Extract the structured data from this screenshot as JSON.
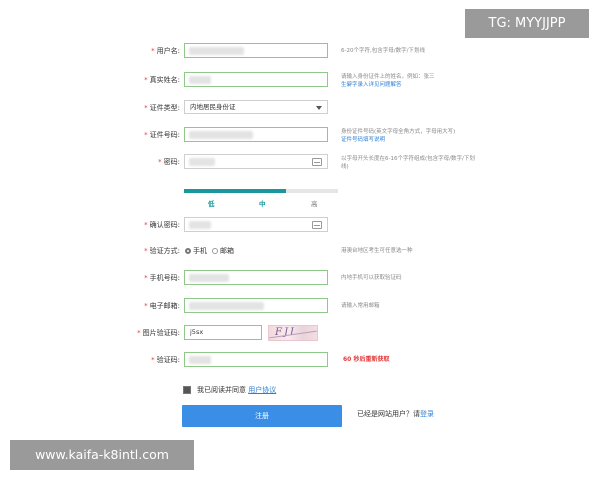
{
  "fields": {
    "username": {
      "label": "用户名:",
      "hint": "6-20个字符,包含字母/数字/下划线"
    },
    "realname": {
      "label": "真实姓名:",
      "hint": "请输入身份证件上的姓名，例如：张三",
      "hint_link": "生僻字录入详见问题解答"
    },
    "id_type": {
      "label": "证件类型:",
      "value": "内地居民身份证"
    },
    "id_number": {
      "label": "证件号码:",
      "hint": "身份证件号码(英文字母全角方式，字母用大写)",
      "hint_link": "证件号码填写说明"
    },
    "password": {
      "label": "密码:",
      "hint": "以字母开头长度在6-16个字符组成(包含字母/数字/下划线)"
    },
    "confirm_password": {
      "label": "确认密码:"
    },
    "verify_method": {
      "label": "验证方式:",
      "hint": "港澳台地区考生可任意选一种",
      "options": [
        "手机",
        "邮箱"
      ],
      "selected": "手机"
    },
    "phone": {
      "label": "手机号码:",
      "hint": "内地手机可以获取验证码"
    },
    "email": {
      "label": "电子邮箱:",
      "hint": "请输入常用邮箱"
    },
    "captcha": {
      "label": "图片验证码:",
      "value": "j5sx",
      "image_text": "FJI"
    },
    "sms_code": {
      "label": "验证码:",
      "countdown": "60 秒后重新获取"
    }
  },
  "password_strength": {
    "labels": [
      "低",
      "中",
      "高"
    ],
    "active": "中",
    "level": 0.66
  },
  "agreement": {
    "text": "我已阅读并同意",
    "link": "用户协议",
    "checked": true
  },
  "submit": {
    "label": "注册"
  },
  "login_prompt": {
    "text": "已经是网站用户？请",
    "link": "登录"
  },
  "watermarks": {
    "tg": "TG: MYYJJPP",
    "url": "www.kaifa-k8intl.com"
  },
  "colors": {
    "required": "#e4393c",
    "accent": "#19979c",
    "button": "#3a8ee6",
    "link": "#2a7fd4",
    "valid_border": "#8fc98a"
  }
}
